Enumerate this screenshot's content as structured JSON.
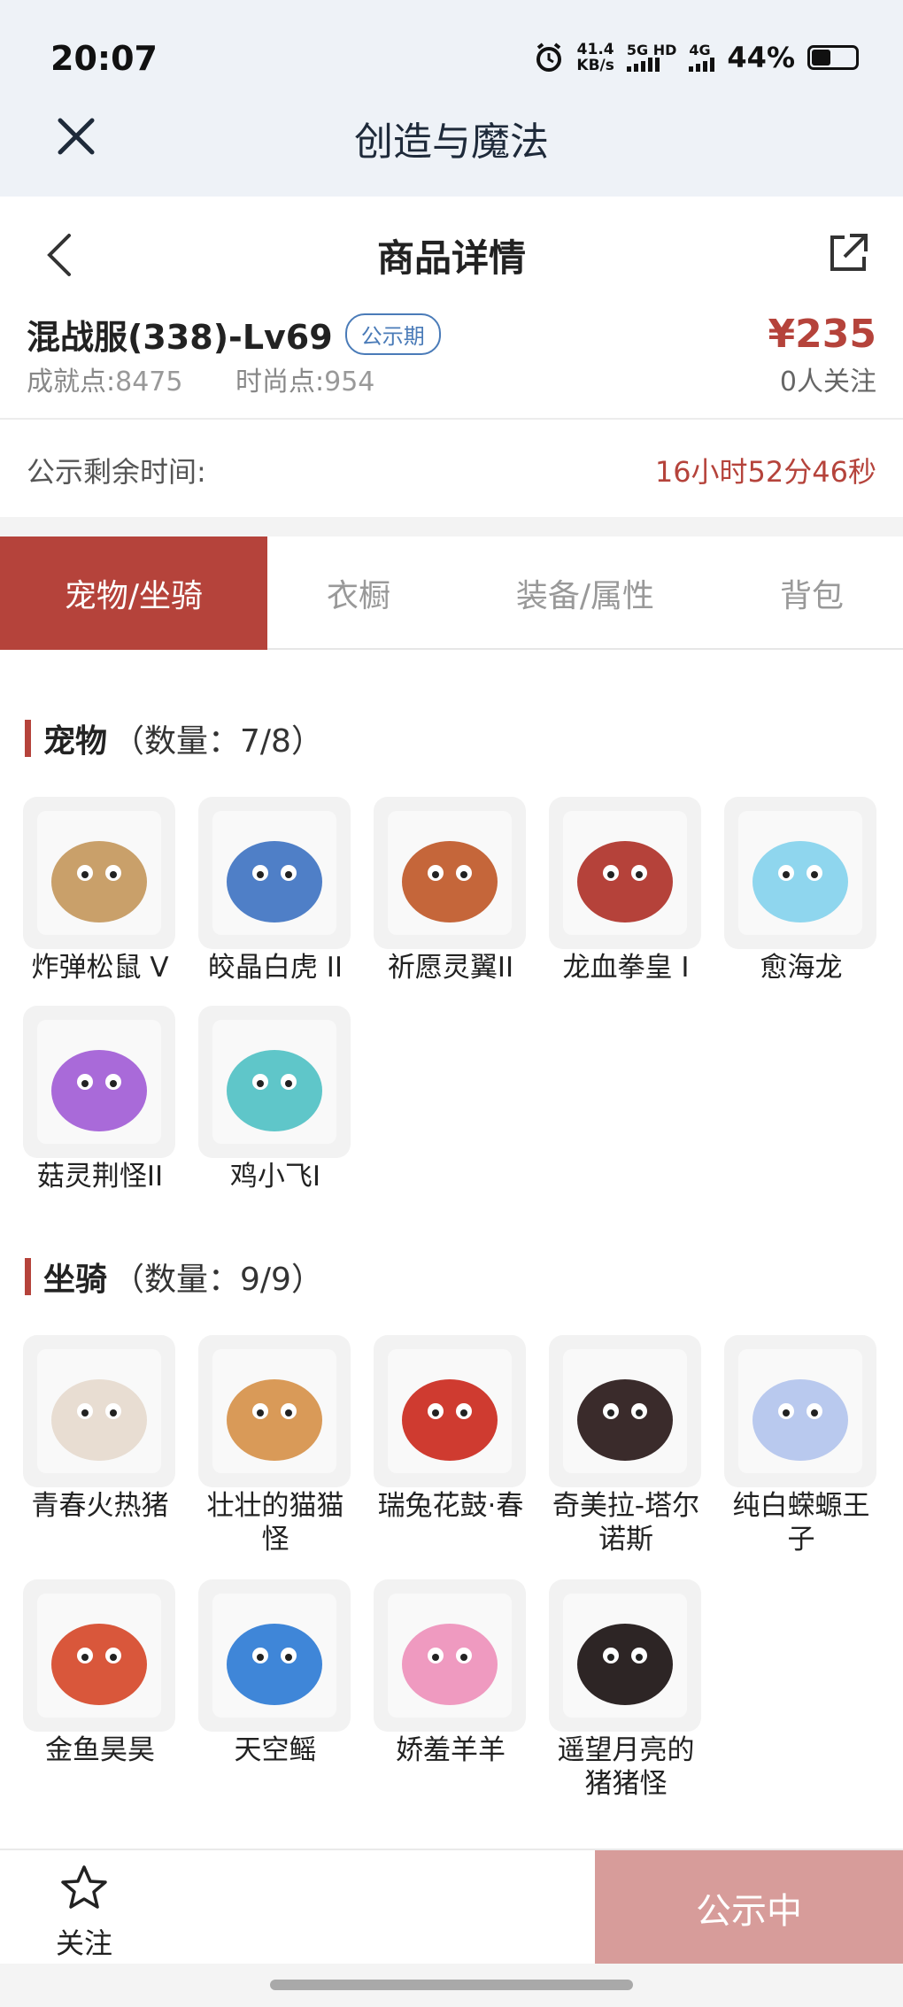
{
  "status_bar": {
    "time": "20:07",
    "net_speed_value": "41.4",
    "net_speed_unit": "KB/s",
    "network_1": "5G HD",
    "network_2": "4G",
    "battery": "44%",
    "battery_level": 0.44,
    "icons": [
      "alarm-icon",
      "signal-icon",
      "battery-icon"
    ]
  },
  "app_bar": {
    "title": "创造与魔法",
    "close_icon": "close-icon"
  },
  "nav": {
    "title": "商品详情",
    "back_icon": "chevron-left-icon",
    "share_icon": "share-icon"
  },
  "item": {
    "name": "混战服(338)-Lv69",
    "badge": "公示期",
    "achievement_label": "成就点:",
    "achievement_value": "8475",
    "fashion_label": "时尚点:",
    "fashion_value": "954",
    "price": "¥235",
    "follow_count": "0人关注"
  },
  "timer": {
    "label": "公示剩余时间:",
    "value": "16小时52分46秒"
  },
  "tabs": [
    {
      "label": "宠物/坐骑",
      "active": true
    },
    {
      "label": "衣橱",
      "active": false
    },
    {
      "label": "装备/属性",
      "active": false
    },
    {
      "label": "背包",
      "active": false
    }
  ],
  "pets": {
    "title": "宠物",
    "count": "（数量：7/8）",
    "items": [
      {
        "name": "炸弹松鼠 V",
        "color": "#c9a06a"
      },
      {
        "name": "皎晶白虎 II",
        "color": "#4f7fc7"
      },
      {
        "name": "祈愿灵翼II",
        "color": "#c5663a"
      },
      {
        "name": "龙血拳皇 I",
        "color": "#b5423a"
      },
      {
        "name": "愈海龙",
        "color": "#8fd6ee"
      },
      {
        "name": "菇灵荆怪II",
        "color": "#a96ad9"
      },
      {
        "name": "鸡小飞I",
        "color": "#5fc6c9"
      }
    ]
  },
  "mounts": {
    "title": "坐骑",
    "count": "（数量：9/9）",
    "items": [
      {
        "name": "青春火热猪",
        "color": "#e8ddd2"
      },
      {
        "name": "壮壮的猫猫怪",
        "color": "#d99a58"
      },
      {
        "name": "瑞兔花鼓·春",
        "color": "#cf3b30"
      },
      {
        "name": "奇美拉-塔尔诺斯",
        "color": "#3a2b2b"
      },
      {
        "name": "纯白蝾螈王子",
        "color": "#b9c9ee"
      },
      {
        "name": "金鱼昊昊",
        "color": "#d9573b"
      },
      {
        "name": "天空鳐",
        "color": "#3f86d8"
      },
      {
        "name": "娇羞羊羊",
        "color": "#ef9ac0"
      },
      {
        "name": "遥望月亮的猪猪怪",
        "color": "#2d2525"
      }
    ]
  },
  "bottom": {
    "follow_label": "关注",
    "action_label": "公示中"
  },
  "colors": {
    "accent": "#b5433b",
    "badge_blue": "#4a7bb8",
    "action_disabled": "#d79c9a"
  }
}
